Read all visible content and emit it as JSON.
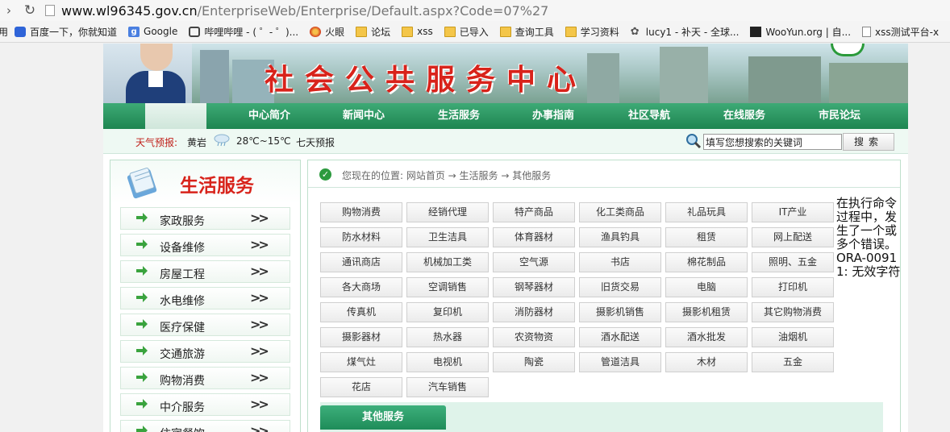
{
  "browser": {
    "url_host": "www.wl96345.gov.cn",
    "url_path": "/EnterpriseWeb/Enterprise/Default.aspx?Code=07%27",
    "bookmarks": [
      {
        "label": "用",
        "icon": "app-icon"
      },
      {
        "label": "百度一下，你就知道",
        "icon": "baidu-icon"
      },
      {
        "label": "Google",
        "icon": "google-icon"
      },
      {
        "label": "哔哩哔哩 - ( ゜- ゜)...",
        "icon": "bilibili-icon"
      },
      {
        "label": "火眼",
        "icon": "fireeye-icon"
      },
      {
        "label": "论坛",
        "icon": "folder-icon"
      },
      {
        "label": "xss",
        "icon": "folder-icon"
      },
      {
        "label": "已导入",
        "icon": "folder-icon"
      },
      {
        "label": "查询工具",
        "icon": "folder-icon"
      },
      {
        "label": "学习资料",
        "icon": "folder-icon"
      },
      {
        "label": "lucy1 - 补天 - 全球...",
        "icon": "butian-icon"
      },
      {
        "label": "WooYun.org | 自...",
        "icon": "wooyun-icon"
      },
      {
        "label": "xss测试平台-x",
        "icon": "page-icon"
      }
    ]
  },
  "banner": {
    "title": "社会公共服务中心"
  },
  "nav": {
    "items": [
      "中心简介",
      "新闻中心",
      "生活服务",
      "办事指南",
      "社区导航",
      "在线服务",
      "市民论坛"
    ]
  },
  "info": {
    "weather_label": "天气预报:",
    "city": "黄岩",
    "temp": "28℃~15℃",
    "week": "七天预报",
    "search_placeholder": "填写您想搜索的关键词",
    "search_button": "搜索"
  },
  "sidebar": {
    "title": "生活服务",
    "items": [
      "家政服务",
      "设备维修",
      "房屋工程",
      "水电维修",
      "医疗保健",
      "交通旅游",
      "购物消费",
      "中介服务",
      "住宿餐饮"
    ]
  },
  "breadcrumb": "您现在的位置: 网站首页 → 生活服务 → 其他服务",
  "categories": [
    "购物消费",
    "经销代理",
    "特产商品",
    "化工类商品",
    "礼品玩具",
    "IT产业",
    "防水材料",
    "卫生洁具",
    "体育器材",
    "渔具钓具",
    "租赁",
    "网上配送",
    "通讯商店",
    "机械加工类",
    "空气源",
    "书店",
    "棉花制品",
    "照明、五金",
    "各大商场",
    "空调销售",
    "钢琴器材",
    "旧货交易",
    "电脑",
    "打印机",
    "传真机",
    "复印机",
    "消防器材",
    "摄影机销售",
    "摄影机租赁",
    "其它购物消费",
    "摄影器材",
    "热水器",
    "农资物资",
    "酒水配送",
    "酒水批发",
    "油烟机",
    "煤气灶",
    "电视机",
    "陶瓷",
    "管道洁具",
    "木材",
    "五金",
    "花店",
    "汽车销售"
  ],
  "tab_label": "其他服务",
  "error_message": "在执行命令过程中，发生了一个或多个错误。ORA-00911: 无效字符",
  "colors": {
    "nav_green": "#1e8550",
    "title_red": "#d8231b",
    "accent_light": "#eef9f3"
  }
}
